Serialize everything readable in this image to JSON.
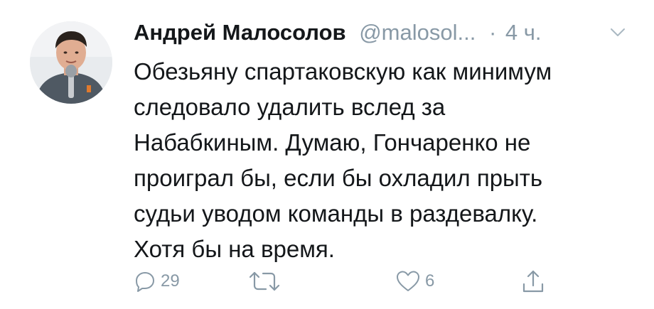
{
  "tweet": {
    "author_name": "Андрей Малосолов",
    "author_handle": "@malosol...",
    "separator": "·",
    "time_ago": "4 ч.",
    "text_lines": [
      "Обезьяну спартаковскую как минимум",
      "следовало удалить вслед за",
      "Набабкиным. Думаю, Гончаренко не",
      "проиграл бы, если бы охладил прыть",
      "судьи уводом команды в раздевалку.",
      "Хотя бы на время."
    ],
    "actions": {
      "reply_count": "29",
      "retweet_count": "",
      "like_count": "6"
    }
  },
  "icons": {
    "reply": "reply-icon",
    "retweet": "retweet-icon",
    "like": "heart-icon",
    "share": "share-icon",
    "menu": "chevron-down-icon"
  },
  "colors": {
    "text": "#14171a",
    "secondary": "#8899a6",
    "background": "#ffffff"
  }
}
